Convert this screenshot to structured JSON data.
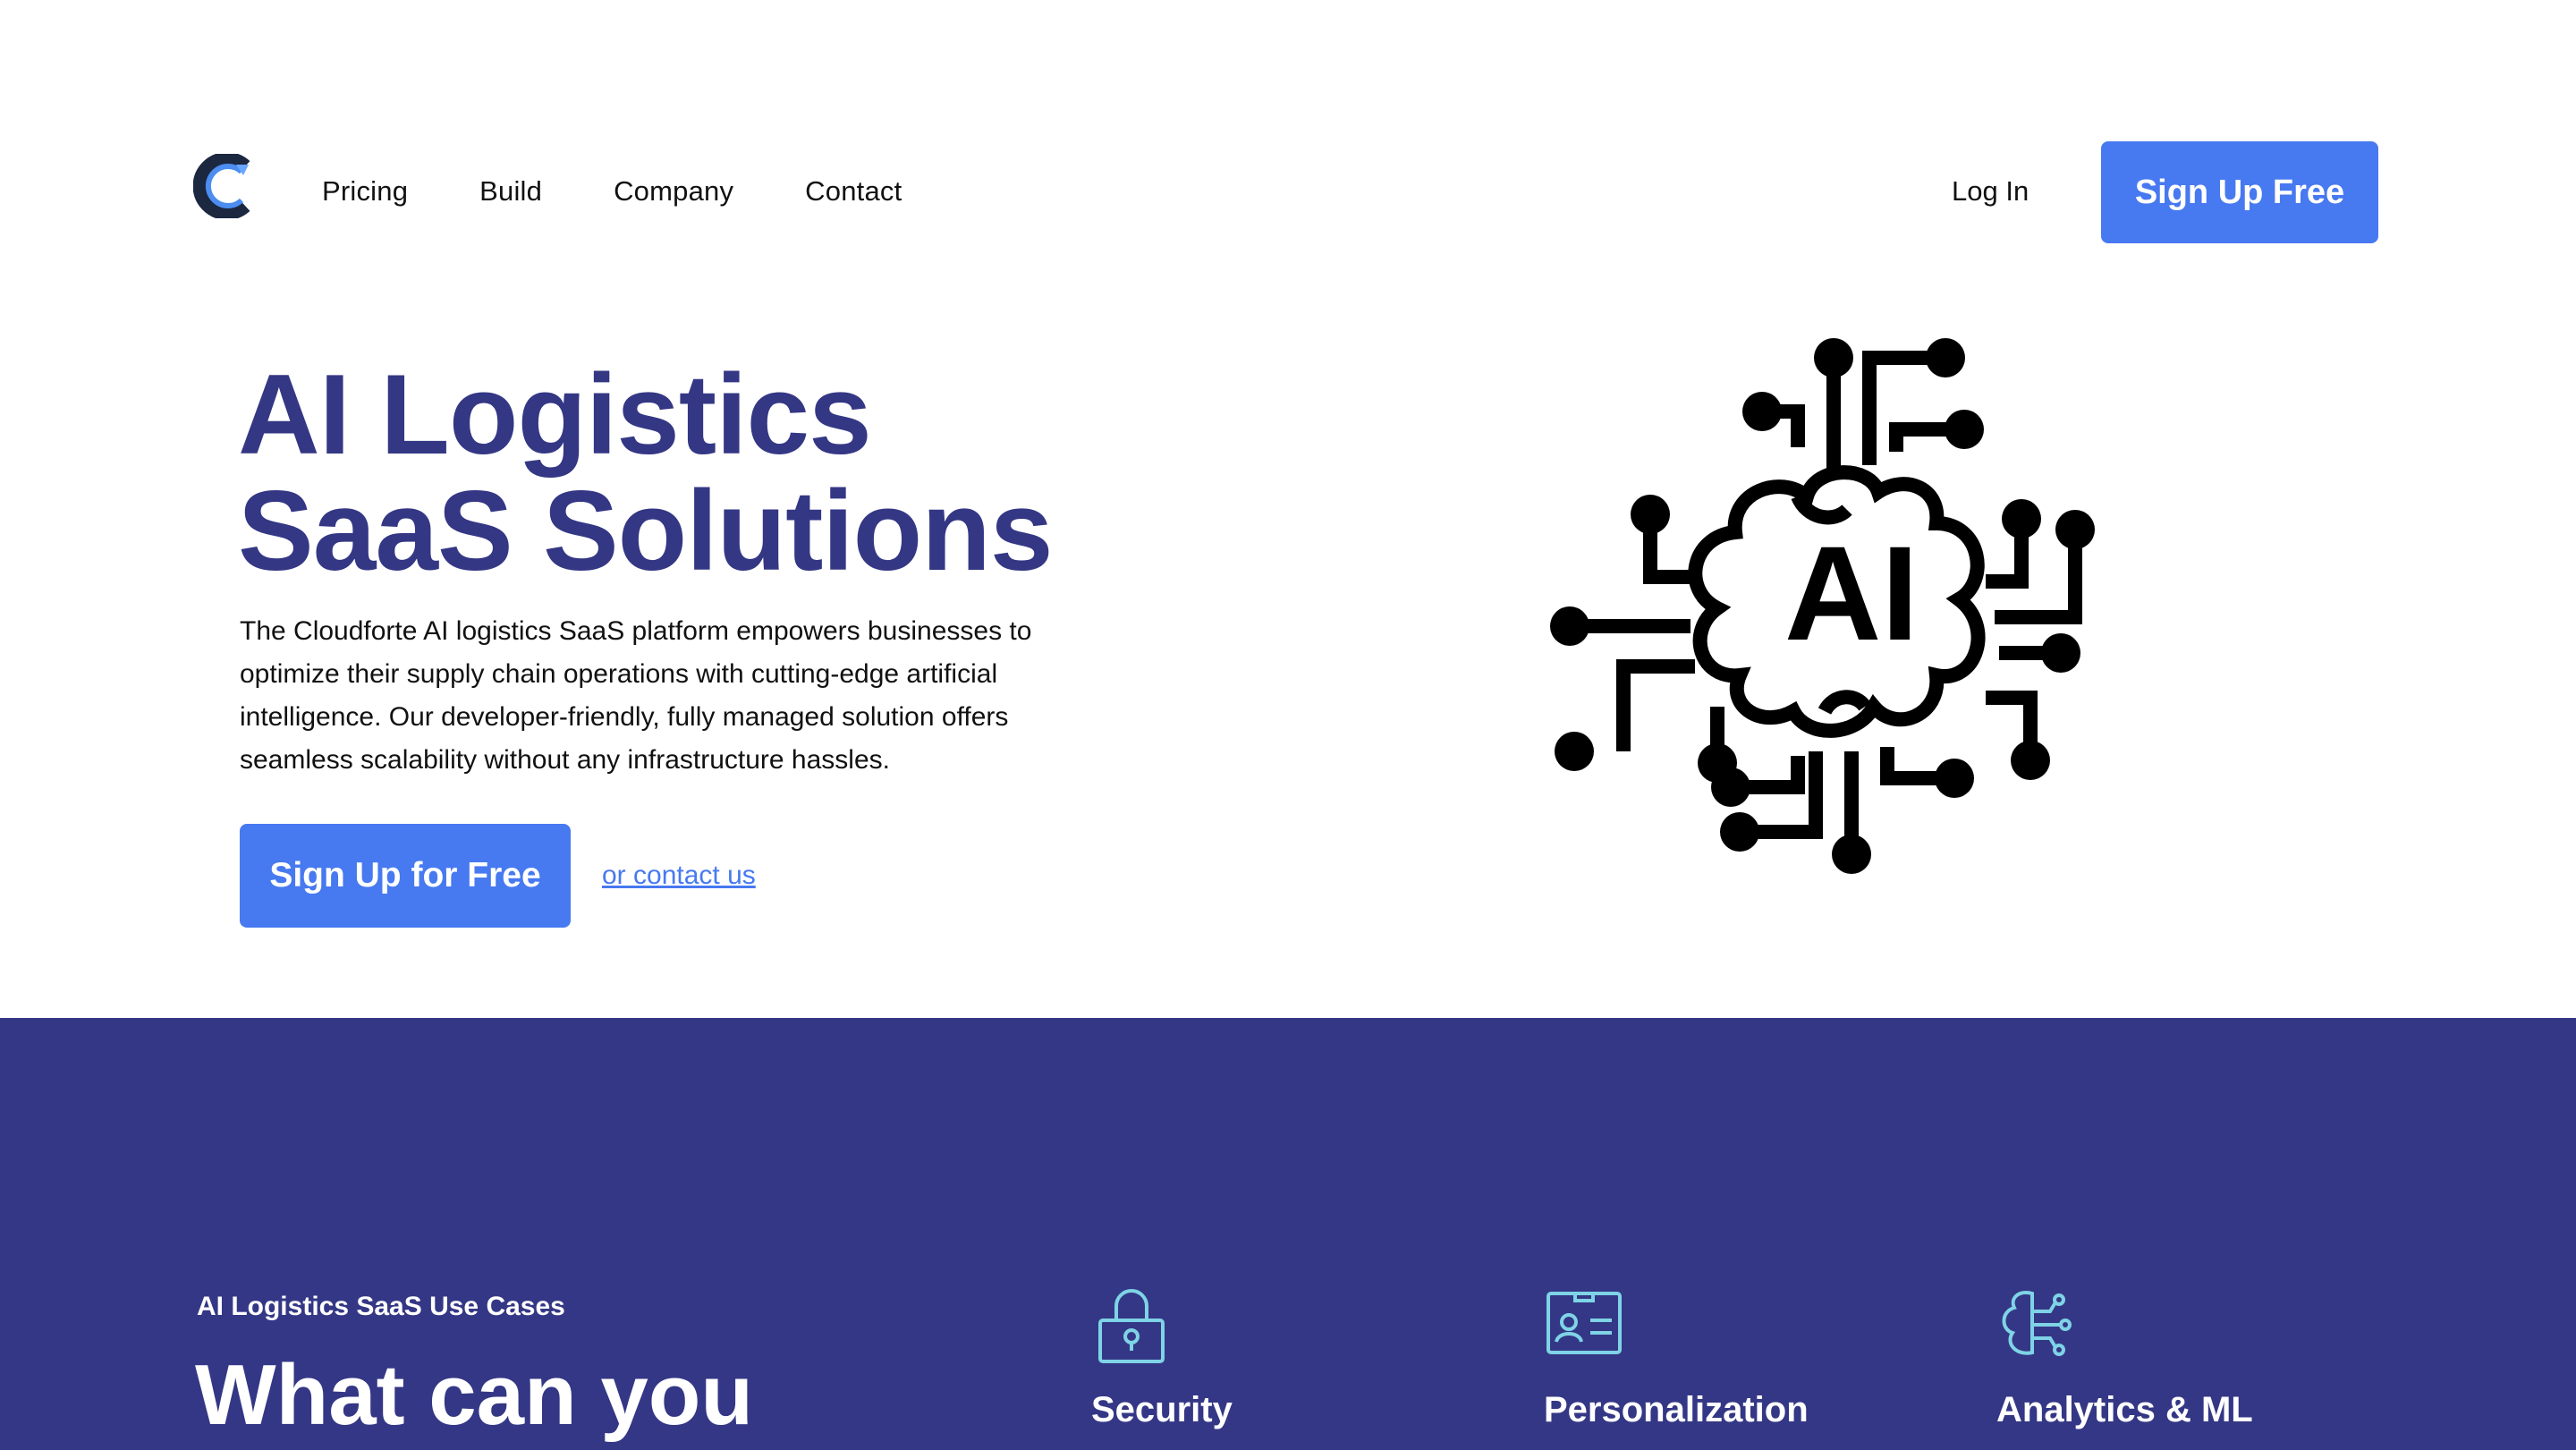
{
  "brand": {
    "logo_letter": "C",
    "primary_color": "#4779f0",
    "dark_color": "#343784"
  },
  "nav": {
    "items": [
      "Pricing",
      "Build",
      "Company",
      "Contact"
    ],
    "login_label": "Log In",
    "signup_label": "Sign Up Free"
  },
  "hero": {
    "title_line1": "AI Logistics",
    "title_line2": "SaaS Solutions",
    "description": "The Cloudforte AI logistics SaaS platform empowers businesses to optimize their supply chain operations with cutting-edge artificial intelligence. Our developer-friendly, fully managed solution offers seamless scalability without any infrastructure hassles.",
    "cta_label": "Sign Up for Free",
    "contact_label": "or contact us",
    "illustration_text": "AI",
    "illustration_icon": "ai-brain-circuit-icon"
  },
  "use_cases": {
    "eyebrow": "AI Logistics SaaS Use Cases",
    "title": "What can you",
    "features": [
      {
        "label": "Security",
        "icon": "lock-icon"
      },
      {
        "label": "Personalization",
        "icon": "id-card-icon"
      },
      {
        "label": "Analytics & ML",
        "icon": "brain-network-icon"
      }
    ]
  }
}
